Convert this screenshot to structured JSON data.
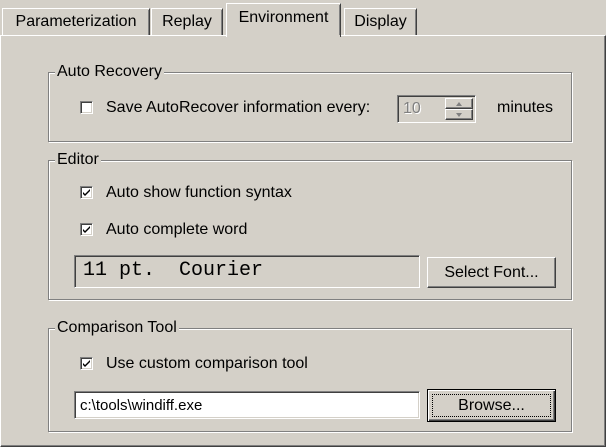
{
  "tabs": [
    {
      "label": "Parameterization",
      "active": false
    },
    {
      "label": "Replay",
      "active": false
    },
    {
      "label": "Environment",
      "active": true
    },
    {
      "label": "Display",
      "active": false
    }
  ],
  "auto_recovery": {
    "title": "Auto Recovery",
    "checkbox_label": "Save AutoRecover information every:",
    "checked": false,
    "interval_value": "10",
    "interval_enabled": false,
    "unit_label": "minutes"
  },
  "editor": {
    "title": "Editor",
    "show_syntax_label": "Auto show function syntax",
    "show_syntax_checked": true,
    "complete_word_label": "Auto complete word",
    "complete_word_checked": true,
    "font_display": "11 pt.  Courier",
    "select_font_label": "Select Font..."
  },
  "comparison_tool": {
    "title": "Comparison Tool",
    "use_custom_label": "Use custom comparison tool",
    "use_custom_checked": true,
    "tool_path": "c:\\tools\\windiff.exe",
    "browse_label": "Browse..."
  }
}
